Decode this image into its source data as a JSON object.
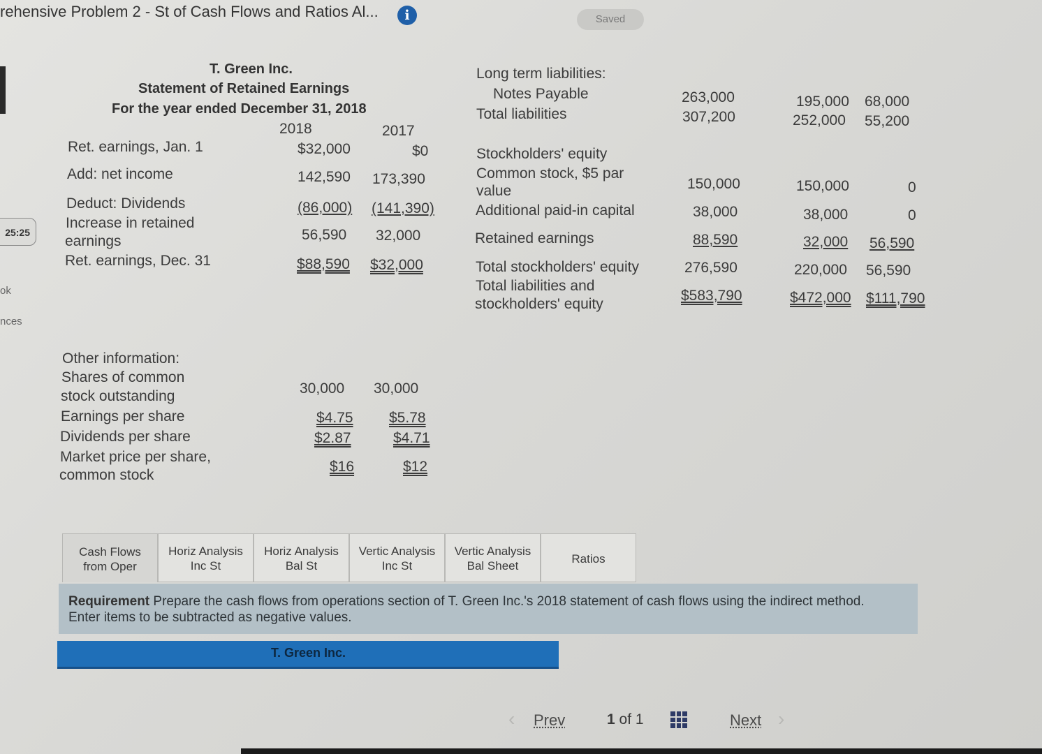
{
  "header": {
    "title": "rehensive Problem 2 - St of Cash Flows and Ratios Al...",
    "info_icon": "i",
    "saved": "Saved"
  },
  "sidebar": {
    "timer": "25:25",
    "link1": "ok",
    "link2": "nces"
  },
  "retained": {
    "company": "T. Green Inc.",
    "statement": "Statement of Retained Earnings",
    "period": "For the year ended December 31, 2018",
    "col_2018": "2018",
    "col_2017": "2017",
    "rows": [
      {
        "label": "Ret. earnings, Jan. 1",
        "v2018": "$32,000",
        "v2017": "$0"
      },
      {
        "label": "Add: net income",
        "v2018": "142,590",
        "v2017": "173,390"
      },
      {
        "label": "Deduct: Dividends",
        "v2018": "(86,000)",
        "v2017": "(141,390)"
      },
      {
        "label_l1": "Increase in retained",
        "label_l2": "earnings",
        "v2018": "56,590",
        "v2017": "32,000"
      },
      {
        "label": "Ret. earnings, Dec. 31",
        "v2018": "$88,590",
        "v2017": "$32,000"
      }
    ]
  },
  "balance": {
    "ltl_header": "Long term liabilities:",
    "notes_payable": {
      "label": "Notes Payable",
      "c1": "263,000",
      "c2": "195,000",
      "c3": "68,000"
    },
    "total_liabilities": {
      "label": "Total liabilities",
      "c1": "307,200",
      "c2": "252,000",
      "c3": "55,200"
    },
    "se_header": "Stockholders' equity",
    "common_stock": {
      "label_l1": "Common stock, $5 par",
      "label_l2": "value",
      "c1": "150,000",
      "c2": "150,000",
      "c3": "0"
    },
    "apic": {
      "label": "Additional paid-in capital",
      "c1": "38,000",
      "c2": "38,000",
      "c3": "0"
    },
    "retained": {
      "label": "Retained earnings",
      "c1": "88,590",
      "c2": "32,000",
      "c3": "56,590"
    },
    "total_se": {
      "label": "Total stockholders' equity",
      "c1": "276,590",
      "c2": "220,000",
      "c3": "56,590"
    },
    "total_l_se": {
      "label_l1": "Total liabilities and",
      "label_l2": "stockholders' equity",
      "c1": "$583,790",
      "c2": "$472,000",
      "c3": "$111,790"
    }
  },
  "other": {
    "header": "Other information:",
    "shares_l1": "Shares of common",
    "shares_l2": "stock outstanding",
    "shares_2018": "30,000",
    "shares_2017": "30,000",
    "eps": "Earnings per share",
    "eps_2018": "$4.75",
    "eps_2017": "$5.78",
    "dps": "Dividends per share",
    "dps_2018": "$2.87",
    "dps_2017": "$4.71",
    "mps_l1": "Market price per share,",
    "mps_l2": "common stock",
    "mps_2018": "$16",
    "mps_2017": "$12"
  },
  "tabs": [
    {
      "l1": "Cash Flows",
      "l2": "from Oper"
    },
    {
      "l1": "Horiz Analysis",
      "l2": "Inc St"
    },
    {
      "l1": "Horiz Analysis",
      "l2": "Bal St"
    },
    {
      "l1": "Vertic Analysis",
      "l2": "Inc St"
    },
    {
      "l1": "Vertic Analysis",
      "l2": "Bal Sheet"
    },
    {
      "l1": "Ratios",
      "l2": ""
    }
  ],
  "requirement": {
    "label": "Requirement",
    "text": "Prepare the cash flows from operations section of T. Green Inc.'s 2018 statement of cash flows using the indirect method.  Enter items to be subtracted as negative values."
  },
  "answer_bar": {
    "label": "T. Green Inc."
  },
  "pager": {
    "prev": "Prev",
    "current": "1",
    "of": "of",
    "total": "1",
    "next": "Next"
  }
}
